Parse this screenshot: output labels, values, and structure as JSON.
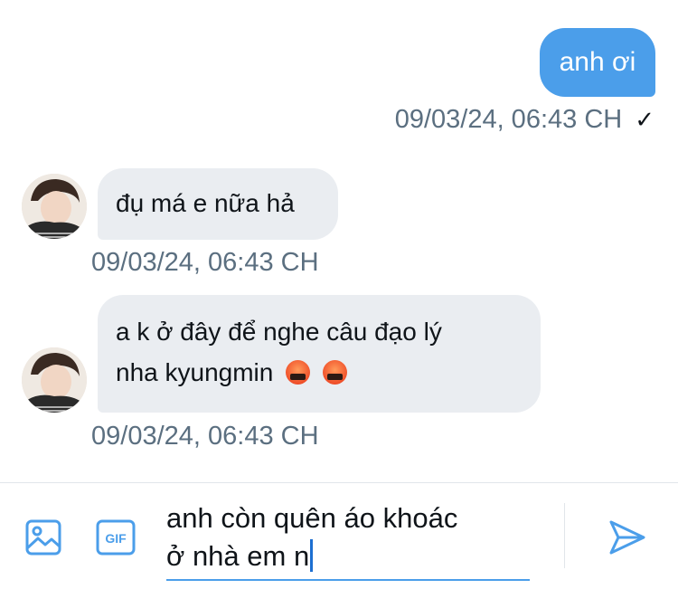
{
  "messages": [
    {
      "direction": "out",
      "text": "anh ơi",
      "timestamp": "09/03/24, 06:43 CH",
      "status": "✓"
    },
    {
      "direction": "in",
      "text": "đụ má e nữa hả",
      "timestamp": "09/03/24, 06:43 CH"
    },
    {
      "direction": "in",
      "line1": "a k ở đây để nghe câu đạo lý",
      "line2": "nha kyungmin",
      "timestamp": "09/03/24, 06:43 CH",
      "emoji_names": [
        "cursing-face-emoji",
        "cursing-face-emoji"
      ]
    }
  ],
  "composer": {
    "line1": "anh còn quên áo khoác",
    "line2": "ở nhà em n",
    "icons": [
      "image-icon",
      "gif-icon",
      "send-icon"
    ]
  },
  "colors": {
    "accent": "#4b9eea",
    "incoming_bubble": "#eaedf1",
    "timestamp_text": "#5b6f80"
  }
}
